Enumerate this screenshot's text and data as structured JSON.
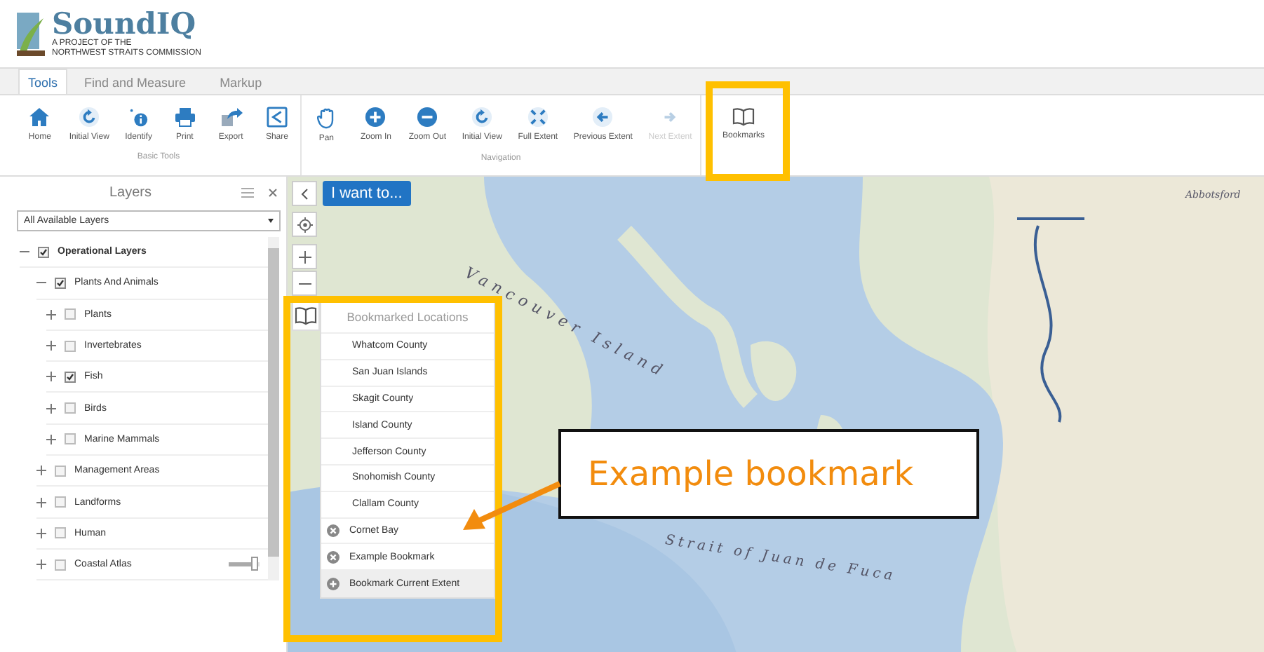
{
  "app": {
    "title": "SoundIQ",
    "subtitle_1": "A PROJECT OF THE",
    "subtitle_2": "NORTHWEST STRAITS COMMISSION"
  },
  "tabs": [
    {
      "label": "Tools",
      "selected": true
    },
    {
      "label": "Find and Measure",
      "selected": false
    },
    {
      "label": "Markup",
      "selected": false
    }
  ],
  "toolbar": {
    "groups": [
      {
        "label": "Basic Tools",
        "tools": [
          {
            "label": "Home",
            "disabled": false
          },
          {
            "label": "Initial View",
            "disabled": false
          },
          {
            "label": "Identify",
            "disabled": false
          },
          {
            "label": "Print",
            "disabled": false
          },
          {
            "label": "Export",
            "disabled": false
          },
          {
            "label": "Share",
            "disabled": false
          }
        ]
      },
      {
        "label": "Navigation",
        "tools": [
          {
            "label": "Pan",
            "disabled": false
          },
          {
            "label": "Zoom In",
            "disabled": false
          },
          {
            "label": "Zoom Out",
            "disabled": false
          },
          {
            "label": "Initial View",
            "disabled": false
          },
          {
            "label": "Full Extent",
            "disabled": false
          },
          {
            "label": "Previous Extent",
            "disabled": false
          },
          {
            "label": "Next Extent",
            "disabled": true
          }
        ]
      },
      {
        "tools": [
          {
            "label": "Bookmarks",
            "disabled": false
          }
        ]
      }
    ]
  },
  "layers_panel": {
    "title": "Layers",
    "filter": "All Available Layers",
    "tree": [
      {
        "label": "Operational Layers",
        "checked": true,
        "expanded": true,
        "children": [
          {
            "label": "Plants And Animals",
            "checked": true,
            "expanded": true,
            "children": [
              {
                "label": "Plants",
                "checked": false,
                "expanded": false
              },
              {
                "label": "Invertebrates",
                "checked": false,
                "expanded": false
              },
              {
                "label": "Fish",
                "checked": true,
                "expanded": false
              },
              {
                "label": "Birds",
                "checked": false,
                "expanded": false
              },
              {
                "label": "Marine Mammals",
                "checked": false,
                "expanded": false
              }
            ]
          },
          {
            "label": "Management Areas",
            "checked": false,
            "expanded": false
          },
          {
            "label": "Landforms",
            "checked": false,
            "expanded": false
          },
          {
            "label": "Human",
            "checked": false,
            "expanded": false
          },
          {
            "label": "Coastal Atlas",
            "checked": false,
            "expanded": false,
            "slider": {
              "level": 0.85
            }
          }
        ]
      }
    ]
  },
  "map": {
    "want_button": "I want to...",
    "labels": [
      {
        "text": "Vancouver Island"
      },
      {
        "text": "Strait of Juan de Fuca"
      },
      {
        "text": "Abbotsford"
      }
    ]
  },
  "bookmarks": {
    "title": "Bookmarked Locations",
    "items": [
      {
        "label": "Whatcom County",
        "kind": "plain"
      },
      {
        "label": "San Juan Islands",
        "kind": "plain"
      },
      {
        "label": "Skagit County",
        "kind": "plain"
      },
      {
        "label": "Island County",
        "kind": "plain"
      },
      {
        "label": "Jefferson County",
        "kind": "plain"
      },
      {
        "label": "Snohomish County",
        "kind": "plain"
      },
      {
        "label": "Clallam County",
        "kind": "plain"
      },
      {
        "label": "Cornet Bay",
        "kind": "removable"
      },
      {
        "label": "Example Bookmark",
        "kind": "removable"
      },
      {
        "label": "Bookmark Current Extent",
        "kind": "add"
      }
    ]
  },
  "annotation": {
    "text": "Example bookmark"
  }
}
